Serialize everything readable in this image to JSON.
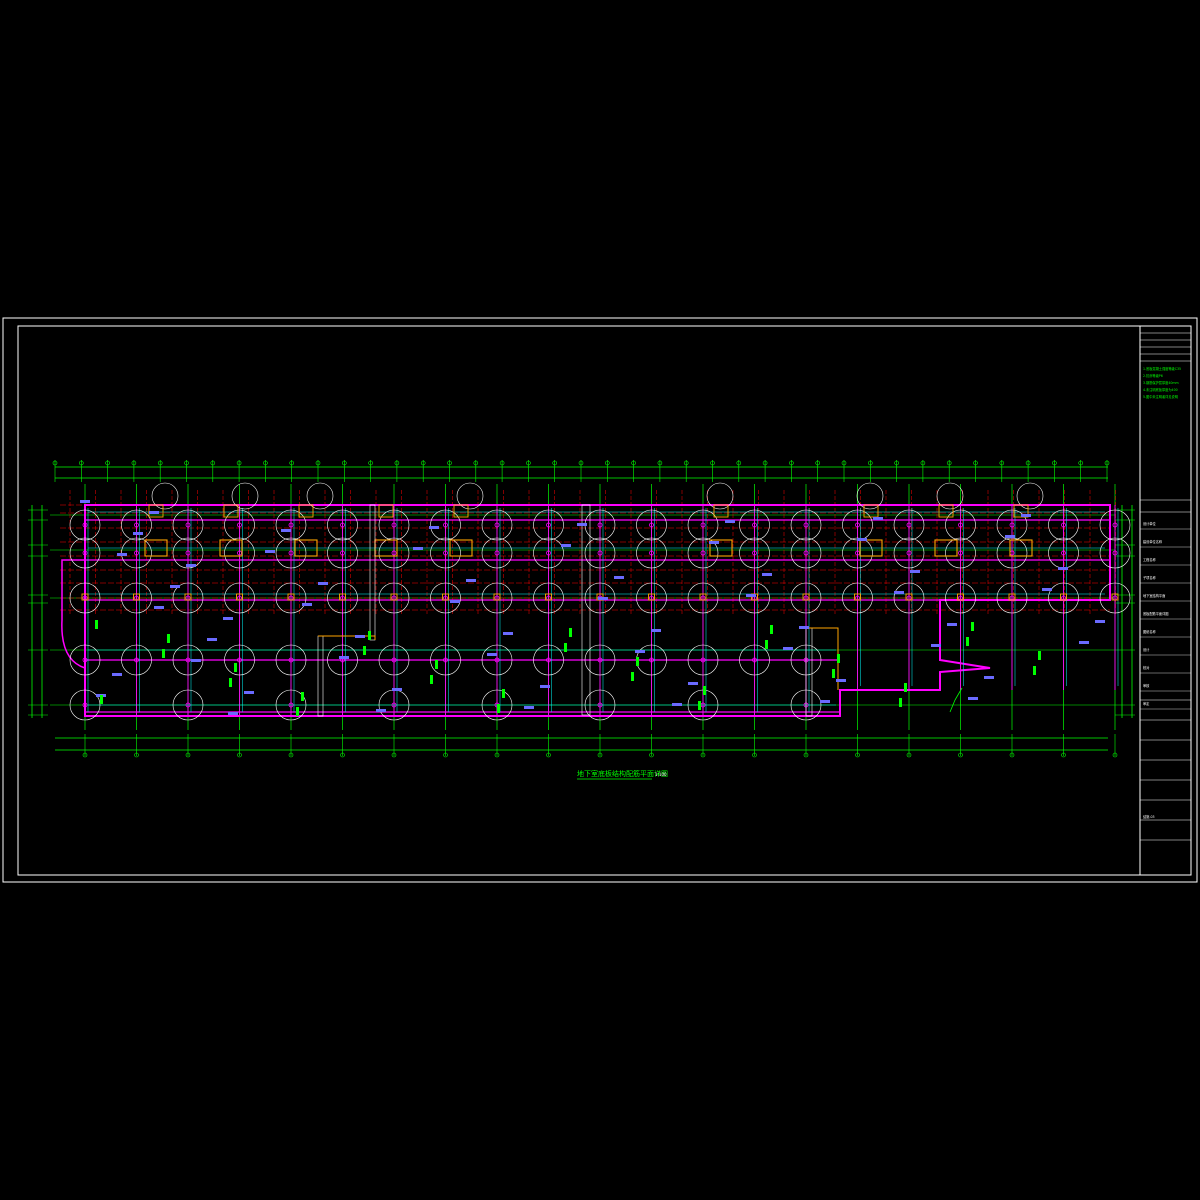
{
  "drawing": {
    "title": "地下室底板结构配筋平面详图",
    "scale": "1:100",
    "colors": {
      "background": "#000000",
      "border": "#ffffff",
      "axis": "#00ff00",
      "grid_red": "#ff0000",
      "beam_magenta": "#ff00ff",
      "beam_cyan": "#00ffff",
      "column_orange": "#ffa500",
      "rebar_blue": "#6a6aff"
    }
  },
  "title_block": {
    "notes": [
      "1.底板混凝土强度等级C35",
      "2.抗渗等级P6",
      "3.钢筋保护层厚度40mm",
      "4.未注明底板厚度为400",
      "5.图中未注明者详见说明"
    ],
    "rows": [
      "设计单位",
      "建设单位名称",
      "工程名称",
      "子项名称",
      "地下室结构平面",
      "底板配筋平面详图",
      "图纸名称",
      "设计",
      "校对",
      "审核",
      "审定"
    ],
    "drawing_no": "结施-03"
  }
}
